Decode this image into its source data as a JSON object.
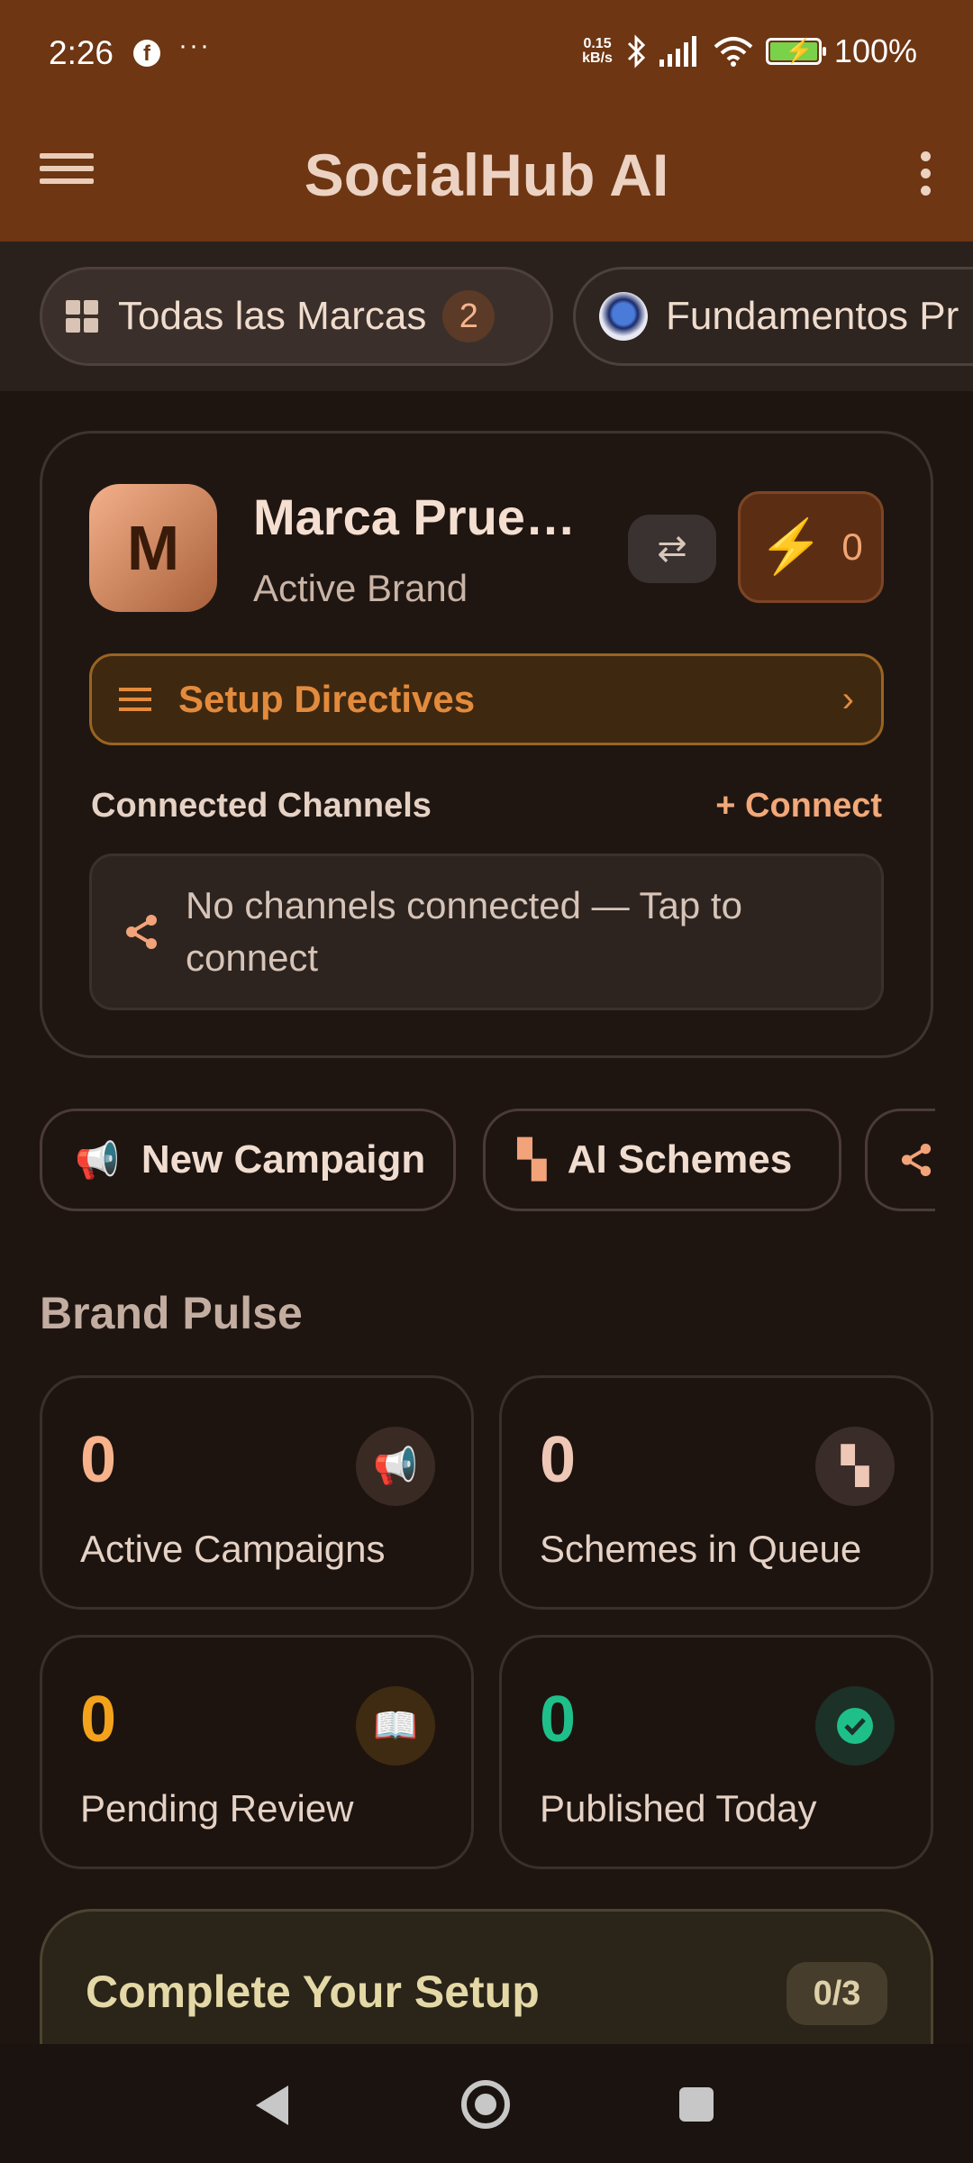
{
  "status_bar": {
    "time": "2:26",
    "net_speed_value": "0.15",
    "net_speed_unit": "kB/s",
    "battery": "100%",
    "icons": [
      "facebook-icon",
      "more-dots-icon",
      "bluetooth-icon",
      "signal-icon",
      "wifi-icon",
      "battery-icon"
    ]
  },
  "app_bar": {
    "title": "SocialHub AI",
    "menu_icon": "hamburger-menu-icon",
    "more_icon": "more-vert-icon"
  },
  "brand_chips": [
    {
      "label": "Todas las Marcas",
      "count": "2",
      "icon": "grid-icon"
    },
    {
      "label": "Fundamentos Pr",
      "icon": "brand-avatar"
    }
  ],
  "brand_card": {
    "initial": "M",
    "name": "Marca Prueb…",
    "subtitle": "Active Brand",
    "switch_icon": "swap-icon",
    "energy_icon": "lightning-icon",
    "energy_count": "0",
    "directives_label": "Setup Directives",
    "channels_label": "Connected Channels",
    "connect_label": "+ Connect",
    "empty_channels": "No channels connected — Tap to connect"
  },
  "quick_actions": [
    {
      "label": "New Campaign",
      "icon": "megaphone-icon"
    },
    {
      "label": "AI Schemes",
      "icon": "scheme-tree-icon"
    },
    {
      "label": "",
      "icon": "share-icon"
    }
  ],
  "brand_pulse": {
    "title": "Brand Pulse",
    "stats": [
      {
        "value": "0",
        "label": "Active Campaigns",
        "icon": "megaphone-icon",
        "color": "#f7b28c"
      },
      {
        "value": "0",
        "label": "Schemes in Queue",
        "icon": "scheme-tree-icon",
        "color": "#eec7b6"
      },
      {
        "value": "0",
        "label": "Pending Review",
        "icon": "book-icon",
        "color": "#f3a31b"
      },
      {
        "value": "0",
        "label": "Published Today",
        "icon": "check-circle-icon",
        "color": "#1fbf8a"
      }
    ]
  },
  "setup": {
    "title": "Complete Your Setup",
    "progress": "0/3"
  },
  "colors": {
    "app_bar": "#6e3613",
    "background": "#1e1511",
    "accent": "#f2a878"
  }
}
